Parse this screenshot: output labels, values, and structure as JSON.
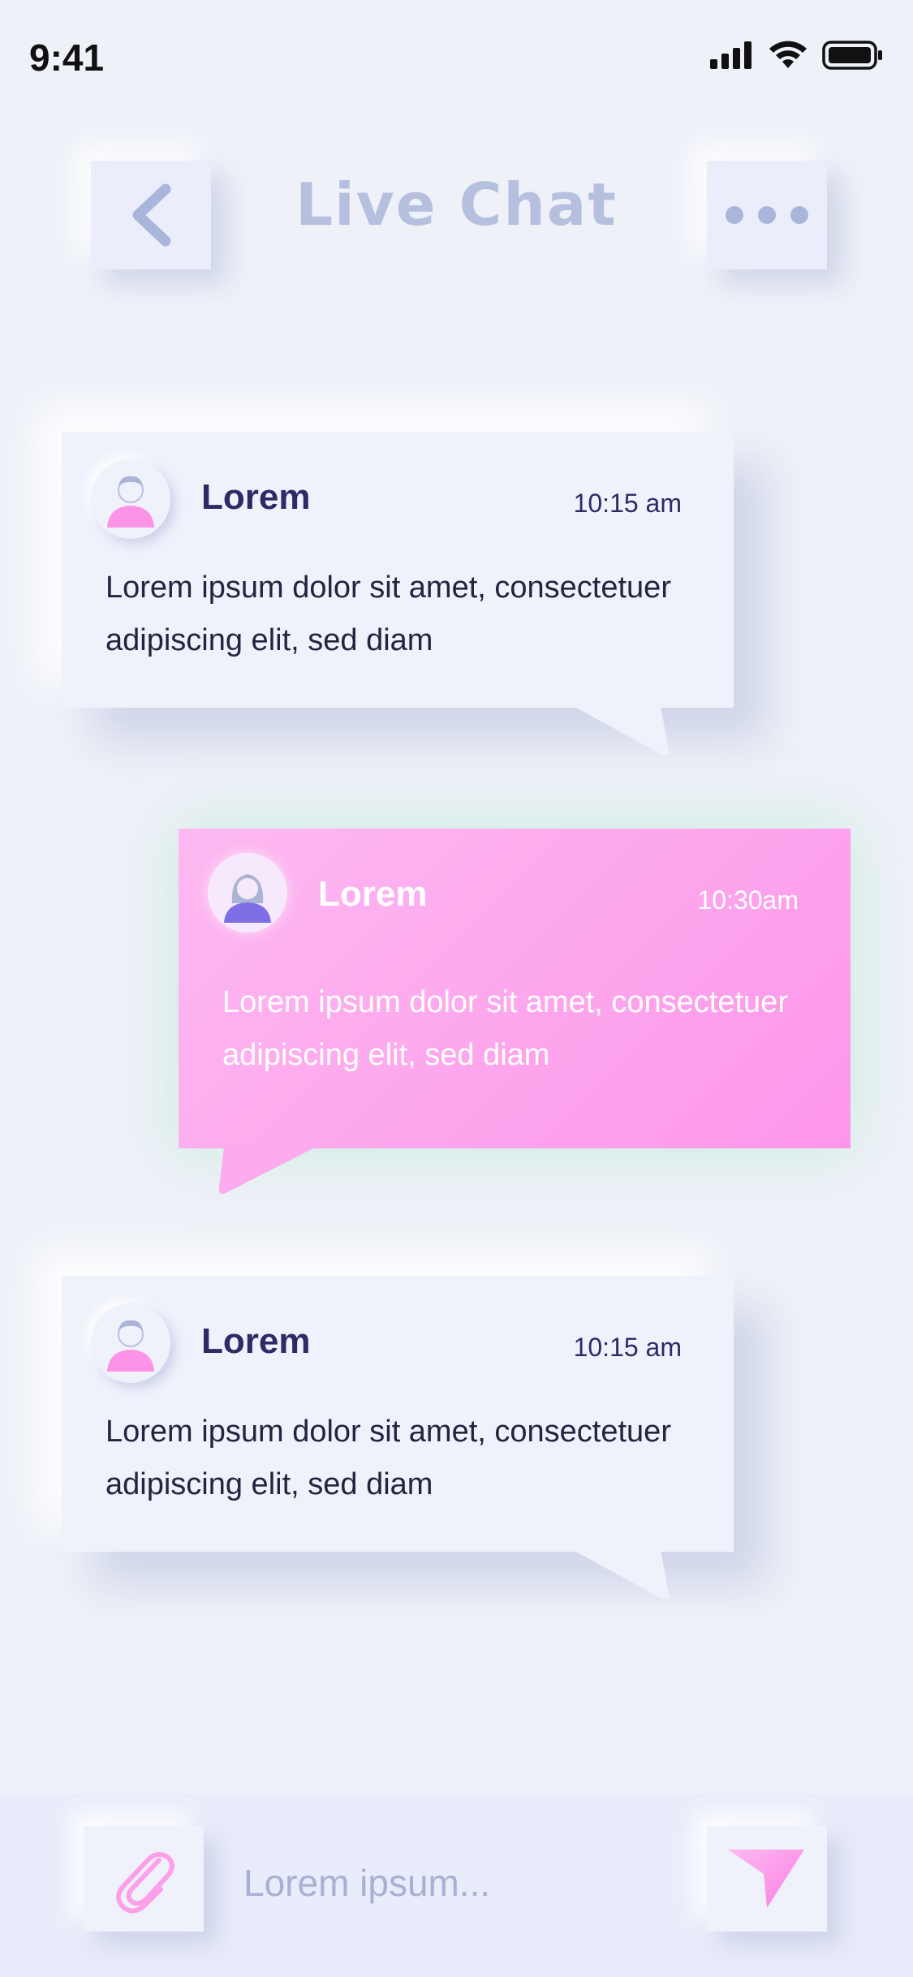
{
  "status_bar": {
    "time": "9:41"
  },
  "header": {
    "title": "Live Chat"
  },
  "messages": [
    {
      "name": "Lorem",
      "time": "10:15 am",
      "text": "Lorem ipsum dolor sit amet, consectetuer adipiscing elit, sed diam",
      "side": "left"
    },
    {
      "name": "Lorem",
      "time": "10:30am",
      "text": "Lorem ipsum dolor sit amet, consectetuer adipiscing elit, sed diam",
      "side": "right"
    },
    {
      "name": "Lorem",
      "time": "10:15 am",
      "text": "Lorem ipsum dolor sit amet, consectetuer adipiscing elit, sed diam",
      "side": "left"
    }
  ],
  "composer": {
    "placeholder": "Lorem ipsum..."
  },
  "icons": {
    "back": "chevron-left-icon",
    "more": "more-dots-icon",
    "attach": "paperclip-icon",
    "send": "send-icon",
    "signal": "signal-icon",
    "wifi": "wifi-icon",
    "battery": "battery-icon"
  },
  "colors": {
    "background": "#eef1f8",
    "accent_pink": "#fd96ea",
    "title": "#b6c0de",
    "name_dark": "#2d2a66"
  }
}
